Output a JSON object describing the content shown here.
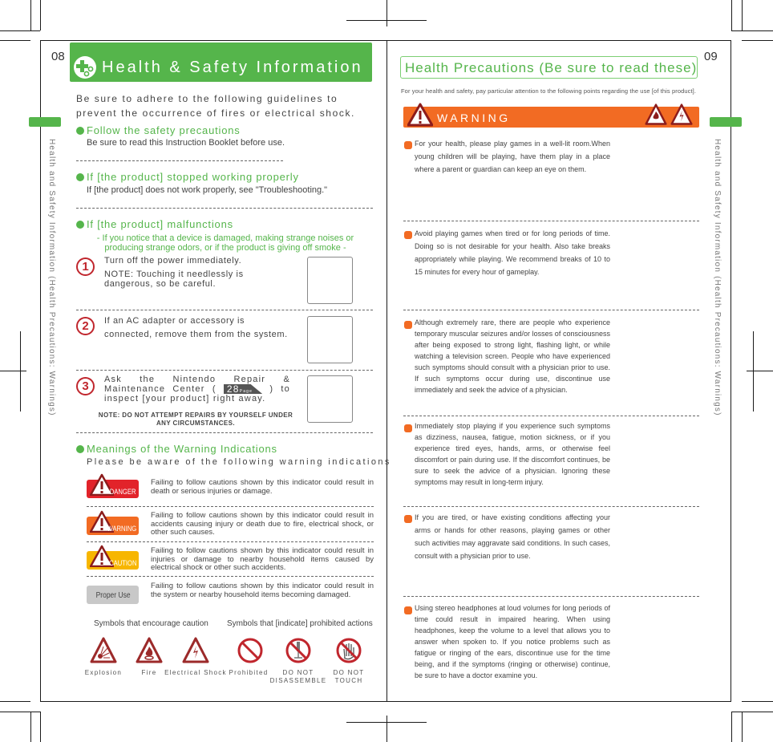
{
  "left_page": {
    "page_number": "08",
    "side_tab_text": "Health and Safety Information (Health Precautions: Warnings)",
    "title": "Health & Safety Information",
    "title_icon": "game-controller-cross-icon",
    "intro": "Be sure to adhere to the following guidelines to prevent the occurrence of fires or electrical shock.",
    "sections": [
      {
        "heading": "Follow the safety precautions",
        "body": "Be sure to read this Instruction Booklet before use."
      },
      {
        "heading": "If [the product] stopped working properly",
        "body": "If [the product] does not work properly, see \"Troubleshooting.\""
      },
      {
        "heading": "If [the product] malfunctions",
        "subtitle": "- If you notice that a device is damaged, making strange noises or producing strange odors, or if the product is giving off smoke -"
      }
    ],
    "steps": [
      {
        "number": "1",
        "text": "Turn off the power immediately.",
        "note": "NOTE: Touching it needlessly is dangerous, so be careful."
      },
      {
        "number": "2",
        "text": "If an AC adapter or accessory is connected, remove them from the system."
      },
      {
        "number": "3",
        "text_before": "Ask the Nintendo Repair & Maintenance Center (",
        "page_ref": "28",
        "page_ref_label": "Page",
        "text_after": ") to inspect [your product] right away.",
        "note": "NOTE: DO NOT ATTEMPT REPAIRS BY YOURSELF UNDER ANY CIRCUMSTANCES."
      }
    ],
    "meanings": {
      "heading": "Meanings of the Warning Indications",
      "subheading": "Please be aware of the following warning indications",
      "items": [
        {
          "label": "DANGER",
          "color": "#e2232a",
          "description": "Failing to follow cautions shown by this indicator could result in death or serious injuries or damage."
        },
        {
          "label": "WARNING",
          "color": "#f26b23",
          "description": "Failing to follow cautions shown by this indicator could result in accidents causing injury or death due to fire, electrical shock, or other such causes."
        },
        {
          "label": "CAUTION",
          "color": "#f7b600",
          "description": "Failing to follow cautions shown by this indicator could result in injuries or damage to nearby household items caused by electrical shock or other such accidents."
        },
        {
          "label": "Proper Use",
          "color": "#c8c8c8",
          "description": "Failing to follow cautions shown by this indicator could result in the system or nearby household items becoming damaged."
        }
      ]
    },
    "symbols": {
      "caution_heading": "Symbols that encourage caution",
      "prohibited_heading": "Symbols that [indicate] prohibited actions",
      "items": [
        {
          "icon": "explosion-icon",
          "label": "Explosion"
        },
        {
          "icon": "fire-icon",
          "label": "Fire"
        },
        {
          "icon": "electrical-shock-icon",
          "label": "Electrical Shock"
        },
        {
          "icon": "prohibited-icon",
          "label": "Prohibited"
        },
        {
          "icon": "do-not-disassemble-icon",
          "label": "DO NOT DISASSEMBLE"
        },
        {
          "icon": "do-not-touch-icon",
          "label": "DO NOT TOUCH"
        }
      ]
    }
  },
  "right_page": {
    "page_number": "09",
    "side_tab_text": "Health and Safety Information (Health Precautions: Warnings)",
    "title": "Health Precautions (Be sure to read these)",
    "subtitle": "For your health and safety, pay particular attention to the following points regarding the use [of this product].",
    "warning_label": "WARNING",
    "warning_icons": [
      "fire-icon",
      "electrical-shock-icon"
    ],
    "items": [
      "For your health, please play games in a well-lit room.When young children will be playing, have them play in a place where a parent or guardian can keep an eye on them.",
      "Avoid playing games when tired or for long periods of time. Doing so is not desirable for your health. Also take breaks appropriately while playing. We recommend breaks of 10 to 15 minutes for every hour of gameplay.",
      "Although extremely rare, there are people who experience temporary muscular seizures and/or losses of consciousness after being exposed to strong light, flashing light, or while watching a television screen. People who have experienced such symptoms should consult with a physician prior to use. If such symptoms occur during use, discontinue use immediately and seek the advice of a physician.",
      "Immediately stop playing if you experience such symptoms as dizziness, nausea, fatigue, motion sickness, or if you experience tired eyes, hands, arms, or otherwise feel discomfort or pain during use. If the discomfort continues, be sure to seek the advice of a physician. Ignoring these symptoms may result in long-term injury.",
      "If you are tired, or have existing conditions affecting your arms or hands for other reasons, playing games or other such activities may aggravate said conditions. In such cases, consult with a physician prior to use.",
      "Using stereo headphones at loud volumes for long periods of time could result in impaired hearing. When using headphones, keep the volume to a level that allows you to answer when spoken to. If you notice problems such as fatigue or ringing of the ears, discontinue use for the time being, and if the symptoms (ringing or otherwise) continue, be sure to have a doctor examine you."
    ]
  },
  "colors": {
    "green_accent": "#55b54b",
    "orange_accent": "#f26b23",
    "step_red": "#c0262d"
  }
}
